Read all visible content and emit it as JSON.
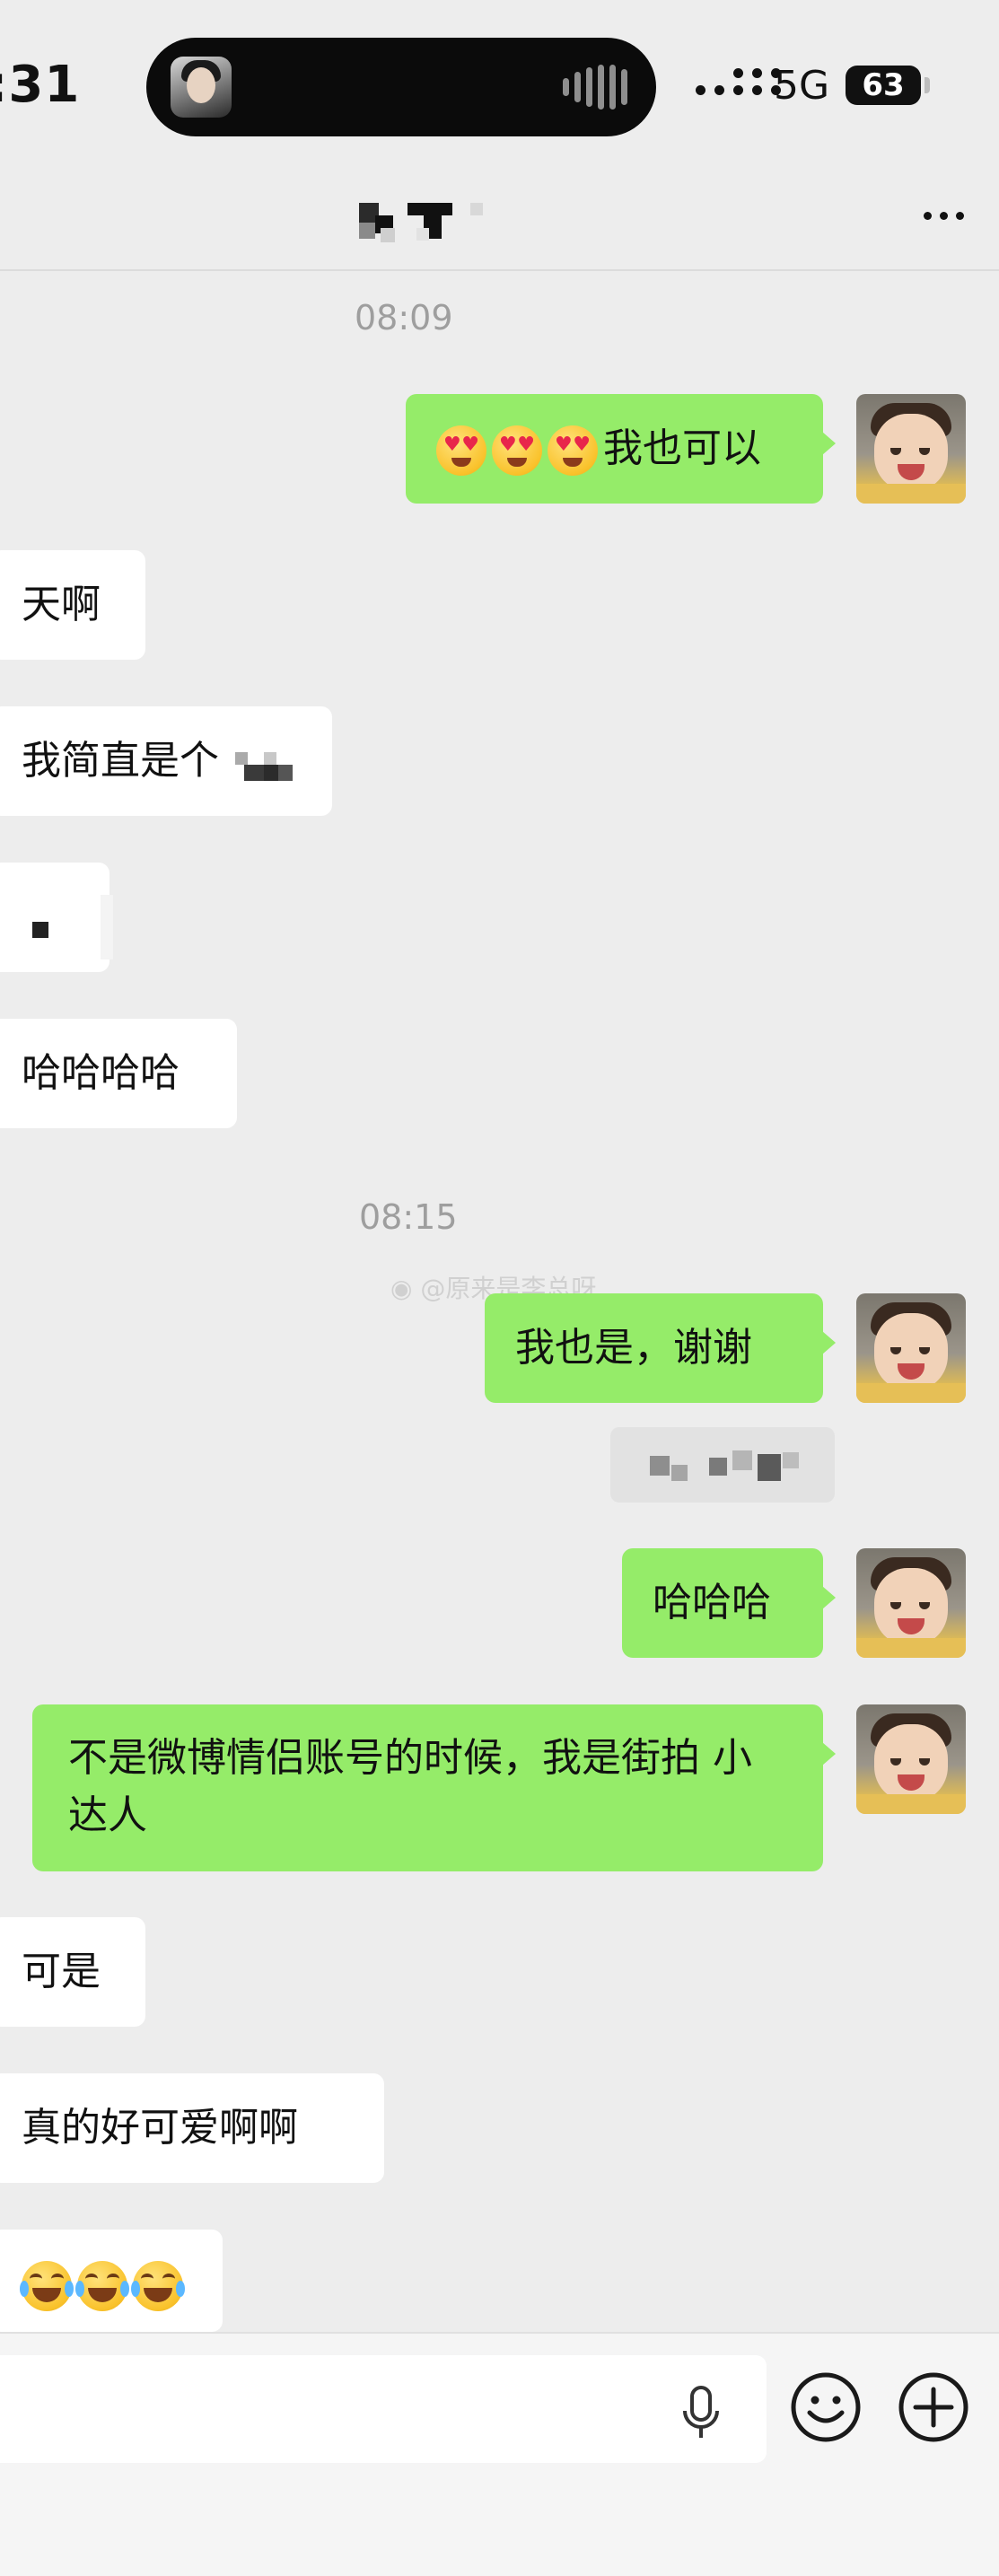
{
  "status_bar": {
    "time": ":31",
    "network": "5G",
    "battery": "63"
  },
  "chat": {
    "timestamps": [
      "08:09",
      "08:15"
    ],
    "messages": [
      {
        "side": "out",
        "text": "我也可以",
        "emoji": [
          "heart-eyes-drooling",
          "heart-eyes-drooling",
          "heart-eyes-drooling"
        ]
      },
      {
        "side": "in",
        "text": "天啊"
      },
      {
        "side": "in",
        "text": "我简直是个"
      },
      {
        "side": "in",
        "text": ""
      },
      {
        "side": "in",
        "text": "哈哈哈哈"
      },
      {
        "side": "out",
        "text": "我也是，谢谢"
      },
      {
        "side": "out",
        "text": "哈哈哈"
      },
      {
        "side": "out",
        "text": "不是微博情侣账号的时候，我是街拍 小达人"
      },
      {
        "side": "in",
        "text": "可是"
      },
      {
        "side": "in",
        "text": "真的好可爱啊啊"
      },
      {
        "side": "in",
        "text": "",
        "emoji": [
          "tears-of-joy",
          "tears-of-joy",
          "tears-of-joy"
        ]
      }
    ],
    "watermark": "@原来是李总呀"
  },
  "input_bar": {
    "icons": [
      "microphone-icon",
      "smiley-icon",
      "plus-icon"
    ]
  },
  "colors": {
    "background": "#ededed",
    "outgoing_bubble": "#95ec69",
    "incoming_bubble": "#ffffff"
  }
}
